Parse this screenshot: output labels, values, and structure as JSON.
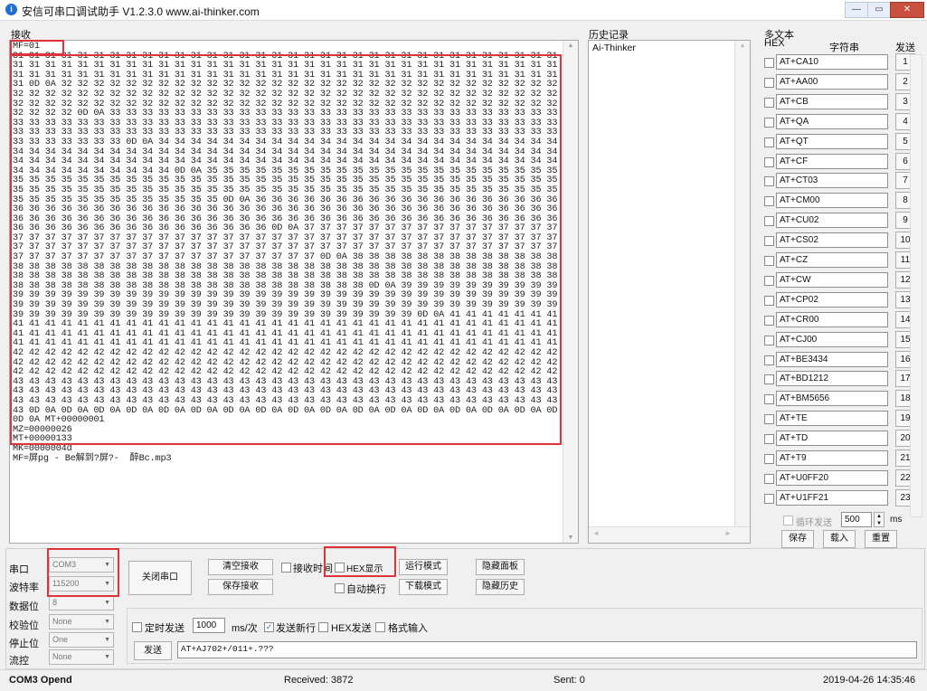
{
  "window": {
    "title": "安信可串口调试助手 V1.2.3.0    www.ai-thinker.com",
    "min_glyph": "—",
    "max_glyph": "▭",
    "close_glyph": "✕"
  },
  "receive": {
    "label": "接收",
    "lines": [
      "MF=01",
      "31 31 31 31 31 31 31 31 31 31 31 31 31 31 31 31 31 31 31 31 31 31 31 31 31 31 31 31 31 31 31 31 31 31 31 31 31 31 31 31 31 31",
      "31 31 31 31 31 31 31 31 31 31 31 31 31 31 31 31 31 31 31 31 31 31 31 31 31 31 31 31 31 31 31 31 31 31 31 31 31 31 31 31 31 31",
      "31 31 31 31 31 31 31 31 31 31 31 31 31 31 31 31 31 31 31 31 31 31 31 31 31 31 31 31 31 31 31 31 31 31 31 31 31 31 31 31 31 31",
      "31 0D 0A 32 32 32 32 32 32 32 32 32 32 32 32 32 32 32 32 32 32 32 32 32 32 32 32 32 32 32 32 32 32 32 32 32 32 32 32 32 32 32",
      "32 32 32 32 32 32 32 32 32 32 32 32 32 32 32 32 32 32 32 32 32 32 32 32 32 32 32 32 32 32 32 32 32 32 32 32 32 32 32 32 32 32",
      "32 32 32 32 32 32 32 32 32 32 32 32 32 32 32 32 32 32 32 32 32 32 32 32 32 32 32 32 32 32 32 32 32 32 32 32 32 32 32 32 32 32",
      "32 32 32 32 0D 0A 33 33 33 33 33 33 33 33 33 33 33 33 33 33 33 33 33 33 33 33 33 33 33 33 33 33 33 33 33 33 33 33 33 33 33 33",
      "33 33 33 33 33 33 33 33 33 33 33 33 33 33 33 33 33 33 33 33 33 33 33 33 33 33 33 33 33 33 33 33 33 33 33 33 33 33 33 33 33 33",
      "33 33 33 33 33 33 33 33 33 33 33 33 33 33 33 33 33 33 33 33 33 33 33 33 33 33 33 33 33 33 33 33 33 33 33 33 33 33 33 33 33 33",
      "33 33 33 33 33 33 33 0D 0A 34 34 34 34 34 34 34 34 34 34 34 34 34 34 34 34 34 34 34 34 34 34 34 34 34 34 34 34 34 34 34 34 34",
      "34 34 34 34 34 34 34 34 34 34 34 34 34 34 34 34 34 34 34 34 34 34 34 34 34 34 34 34 34 34 34 34 34 34 34 34 34 34 34 34 34 34",
      "34 34 34 34 34 34 34 34 34 34 34 34 34 34 34 34 34 34 34 34 34 34 34 34 34 34 34 34 34 34 34 34 34 34 34 34 34 34 34 34 34 34",
      "34 34 34 34 34 34 34 34 34 34 0D 0A 35 35 35 35 35 35 35 35 35 35 35 35 35 35 35 35 35 35 35 35 35 35 35 35 35 35 35 35 35 35",
      "35 35 35 35 35 35 35 35 35 35 35 35 35 35 35 35 35 35 35 35 35 35 35 35 35 35 35 35 35 35 35 35 35 35 35 35 35 35 35 35 35 35",
      "35 35 35 35 35 35 35 35 35 35 35 35 35 35 35 35 35 35 35 35 35 35 35 35 35 35 35 35 35 35 35 35 35 35 35 35 35 35 35 35 35 35",
      "35 35 35 35 35 35 35 35 35 35 35 35 35 0D 0A 36 36 36 36 36 36 36 36 36 36 36 36 36 36 36 36 36 36 36 36 36 36 36 36 36 36 36",
      "36 36 36 36 36 36 36 36 36 36 36 36 36 36 36 36 36 36 36 36 36 36 36 36 36 36 36 36 36 36 36 36 36 36 36 36 36 36 36 36 36 36",
      "36 36 36 36 36 36 36 36 36 36 36 36 36 36 36 36 36 36 36 36 36 36 36 36 36 36 36 36 36 36 36 36 36 36 36 36 36 36 36 36 36 36",
      "36 36 36 36 36 36 36 36 36 36 36 36 36 36 36 36 0D 0A 37 37 37 37 37 37 37 37 37 37 37 37 37 37 37 37 37 37 37 37 37 37 37 37",
      "37 37 37 37 37 37 37 37 37 37 37 37 37 37 37 37 37 37 37 37 37 37 37 37 37 37 37 37 37 37 37 37 37 37 37 37 37 37 37 37 37 37",
      "37 37 37 37 37 37 37 37 37 37 37 37 37 37 37 37 37 37 37 37 37 37 37 37 37 37 37 37 37 37 37 37 37 37 37 37 37 37 37 37 37 37",
      "37 37 37 37 37 37 37 37 37 37 37 37 37 37 37 37 37 37 37 0D 0A 38 38 38 38 38 38 38 38 38 38 38 38 38 38 38 38 38 38 38 38 38",
      "38 38 38 38 38 38 38 38 38 38 38 38 38 38 38 38 38 38 38 38 38 38 38 38 38 38 38 38 38 38 38 38 38 38 38 38 38 38 38 38 38 38",
      "38 38 38 38 38 38 38 38 38 38 38 38 38 38 38 38 38 38 38 38 38 38 38 38 38 38 38 38 38 38 38 38 38 38 38 38 38 38 38 38 38 38",
      "38 38 38 38 38 38 38 38 38 38 38 38 38 38 38 38 38 38 38 38 38 38 0D 0A 39 39 39 39 39 39 39 39 39 39 39 39 39 39 39 39 39 39",
      "39 39 39 39 39 39 39 39 39 39 39 39 39 39 39 39 39 39 39 39 39 39 39 39 39 39 39 39 39 39 39 39 39 39 39 39 39 39 39 39 39 39",
      "39 39 39 39 39 39 39 39 39 39 39 39 39 39 39 39 39 39 39 39 39 39 39 39 39 39 39 39 39 39 39 39 39 39 39 39 39 39 39 39 39 39",
      "39 39 39 39 39 39 39 39 39 39 39 39 39 39 39 39 39 39 39 39 39 39 39 39 39 0D 0A 41 41 41 41 41 41 41 41 41 41 41 41 41 41 41",
      "41 41 41 41 41 41 41 41 41 41 41 41 41 41 41 41 41 41 41 41 41 41 41 41 41 41 41 41 41 41 41 41 41 41 41 41 41 41 41 41 41 41",
      "41 41 41 41 41 41 41 41 41 41 41 41 41 41 41 41 41 41 41 41 41 41 41 41 41 41 41 41 41 41 41 41 41 41 41 41 41 41 41 41 41 41",
      "41 41 41 41 41 41 41 41 41 41 41 41 41 41 41 41 41 41 41 41 41 41 41 41 41 41 41 41 41 41 41 41 41 41 41 41 0D 0A 42 42 42 42",
      "42 42 42 42 42 42 42 42 42 42 42 42 42 42 42 42 42 42 42 42 42 42 42 42 42 42 42 42 42 42 42 42 42 42 42 42 42 42 42 42 42 42",
      "42 42 42 42 42 42 42 42 42 42 42 42 42 42 42 42 42 42 42 42 42 42 42 42 42 42 42 42 42 42 42 42 42 42 42 42 42 42 42 42 42 42",
      "42 42 42 42 42 42 42 42 42 42 42 42 42 42 42 42 42 42 42 42 42 42 42 42 42 42 42 42 42 42 42 42 42 42 42 42 42 42 42 42 0D 0A",
      "43 43 43 43 43 43 43 43 43 43 43 43 43 43 43 43 43 43 43 43 43 43 43 43 43 43 43 43 43 43 43 43 43 43 43 43 43 43 43 43 43 43",
      "43 43 43 43 43 43 43 43 43 43 43 43 43 43 43 43 43 43 43 43 43 43 43 43 43 43 43 43 43 43 43 43 43 43 43 43 43 43 43 43 43 43",
      "43 43 43 43 43 43 43 43 43 43 43 43 43 43 43 43 43 43 43 43 43 43 43 43 43 43 43 43 43 43 43 43 43 43 43 43 43 43 43 43 43 43",
      "43 0D 0A 0D 0A 0D 0A 0D 0A 0D 0A 0D 0A 0D 0A 0D 0A 0D 0A 0D 0A 0D 0A 0D 0A 0D 0A 0D 0A 0D 0A 0D 0A 0D 0A 0D 0A 0D 0A 0D 0A",
      "0D 0A MT+00000001",
      "MZ=00000026",
      "MT+00000133",
      "MK=0000004d",
      "MF=屏pg - Be解到?屏?-  醉Bc.mp3"
    ]
  },
  "history": {
    "label": "历史记录",
    "items": [
      "Ai-Thinker"
    ]
  },
  "multi_text": {
    "label": "多文本",
    "col_hex": "HEX",
    "col_string": "字符串",
    "col_send": "发送",
    "commands": [
      {
        "text": "AT+CA10",
        "num": "1"
      },
      {
        "text": "AT+AA00",
        "num": "2"
      },
      {
        "text": "AT+CB",
        "num": "3"
      },
      {
        "text": "AT+QA",
        "num": "4"
      },
      {
        "text": "AT+QT",
        "num": "5"
      },
      {
        "text": "AT+CF",
        "num": "6"
      },
      {
        "text": "AT+CT03",
        "num": "7"
      },
      {
        "text": "AT+CM00",
        "num": "8"
      },
      {
        "text": "AT+CU02",
        "num": "9"
      },
      {
        "text": "AT+CS02",
        "num": "10"
      },
      {
        "text": "AT+CZ",
        "num": "11"
      },
      {
        "text": "AT+CW",
        "num": "12"
      },
      {
        "text": "AT+CP02",
        "num": "13"
      },
      {
        "text": "AT+CR00",
        "num": "14"
      },
      {
        "text": "AT+CJ00",
        "num": "15"
      },
      {
        "text": "AT+BE3434",
        "num": "16"
      },
      {
        "text": "AT+BD1212",
        "num": "17"
      },
      {
        "text": "AT+BM5656",
        "num": "18"
      },
      {
        "text": "AT+TE",
        "num": "19"
      },
      {
        "text": "AT+TD",
        "num": "20"
      },
      {
        "text": "AT+T9",
        "num": "21"
      },
      {
        "text": "AT+U0FF20",
        "num": "22"
      },
      {
        "text": "AT+U1FF21",
        "num": "23"
      }
    ],
    "loop_label": "循环发送",
    "loop_value": "500",
    "loop_unit": "ms",
    "save_label": "保存",
    "load_label": "载入",
    "reset_label": "重置"
  },
  "settings": {
    "port_label": "串口",
    "port_value": "COM3",
    "baud_label": "波特率",
    "baud_value": "115200",
    "databits_label": "数据位",
    "databits_value": "8",
    "parity_label": "校验位",
    "parity_value": "None",
    "stopbits_label": "停止位",
    "stopbits_value": "One",
    "flow_label": "流控",
    "flow_value": "None"
  },
  "buttons": {
    "close_port": "关闭串口",
    "clear_recv": "清空接收",
    "save_recv": "保存接收",
    "recv_time": "接收时间",
    "hex_display": "HEX显示",
    "run_mode": "运行模式",
    "hide_panel": "隐藏面板",
    "auto_newline": "自动换行",
    "download_mode": "下载模式",
    "hide_history": "隐藏历史",
    "timed_send": "定时发送",
    "timed_value": "1000",
    "timed_unit": "ms/次",
    "send_newline": "发送新行",
    "hex_send": "HEX发送",
    "format_input": "格式输入",
    "send": "发送",
    "send_text": "AT+AJ702+/011+.???"
  },
  "status": {
    "port_state": "COM3 Opend",
    "received": "Received: 3872",
    "sent": "Sent: 0",
    "datetime": "2019-04-26 14:35:46"
  },
  "colors": {
    "highlight": "#e0323a",
    "accent": "#1e6fd9"
  }
}
